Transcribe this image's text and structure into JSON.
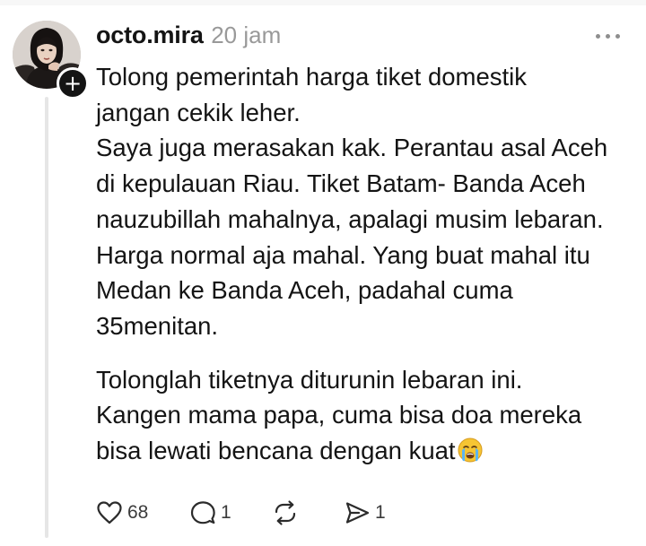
{
  "post": {
    "username": "octo.mira",
    "timestamp": "20 jam",
    "caption_lines": [
      "Tolong pemerintah harga tiket domestik\njangan cekik leher.\nSaya juga merasakan kak. Perantau asal Aceh\ndi kepulauan Riau. Tiket Batam- Banda Aceh\nnauzubillah mahalnya, apalagi musim lebaran.\nHarga normal aja mahal. Yang buat mahal itu\nMedan ke Banda Aceh, padahal cuma\n35menitan.",
      "Tolonglah tiketnya diturunin lebaran ini.\nKangen mama papa, cuma bisa doa mereka\nbisa lewati bencana dengan kuat"
    ],
    "caption_emoji": "crying-face-emoji"
  },
  "actions": {
    "like_count": "68",
    "reply_count": "1",
    "repost_count": "",
    "share_count": "1"
  },
  "icons": {
    "follow": "plus-icon",
    "more": "ellipsis-icon",
    "like": "heart-icon",
    "reply": "comment-bubble-icon",
    "repost": "repost-arrows-icon",
    "share": "send-icon"
  },
  "colors": {
    "text": "#141414",
    "muted": "#999999",
    "thread_line": "#e6e6e6"
  }
}
